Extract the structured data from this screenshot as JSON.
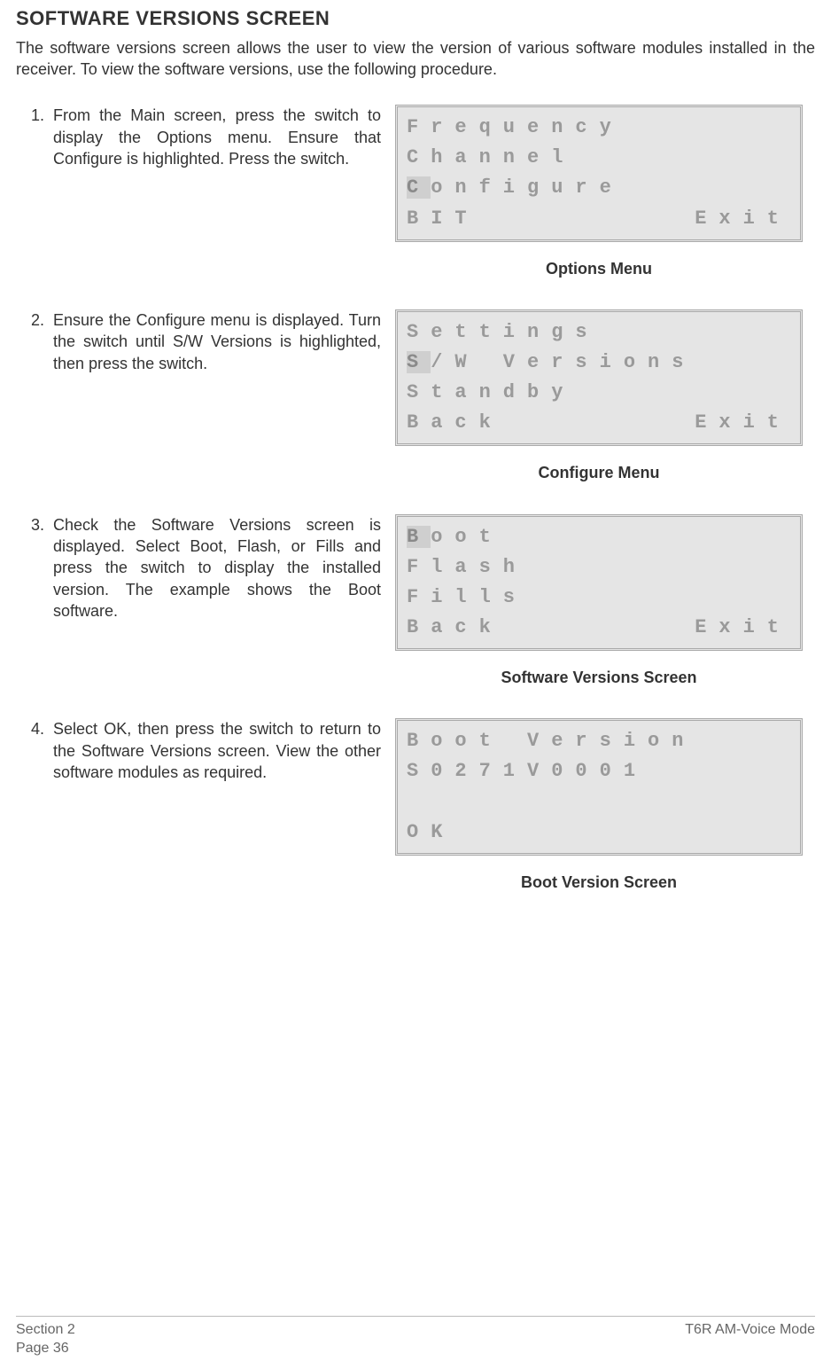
{
  "heading": "SOFTWARE VERSIONS SCREEN",
  "intro": "The software versions screen allows the user to view the version of various software modules installed in the receiver. To view the software versions, use the following procedure.",
  "steps": [
    {
      "num": "1.",
      "text": "From the Main screen, press the switch to display the Options menu. Ensure that Configure is highlighted. Press the switch.",
      "lcd": {
        "rows": [
          {
            "left": "Frequency",
            "right": "",
            "hl_first": false
          },
          {
            "left": "Channel",
            "right": "",
            "hl_first": false
          },
          {
            "left": "Configure",
            "right": "",
            "hl_first": true
          },
          {
            "left": "BIT",
            "right": "Exit",
            "hl_first": false
          }
        ]
      },
      "caption": "Options Menu"
    },
    {
      "num": "2.",
      "text": "Ensure the Configure menu is displayed. Turn the switch until S/W Versions is highlighted, then press the switch.",
      "lcd": {
        "rows": [
          {
            "left": "Settings",
            "right": "",
            "hl_first": false
          },
          {
            "left": "S/W Versions",
            "right": "",
            "hl_first": true
          },
          {
            "left": "Standby",
            "right": "",
            "hl_first": false
          },
          {
            "left": "Back",
            "right": "Exit",
            "hl_first": false
          }
        ]
      },
      "caption": "Configure Menu"
    },
    {
      "num": "3.",
      "text": "Check the Software Versions screen is displayed. Select Boot, Flash, or Fills and press the switch to display the installed version. The example shows the Boot software.",
      "lcd": {
        "rows": [
          {
            "left": "Boot",
            "right": "",
            "hl_first": true
          },
          {
            "left": "Flash",
            "right": "",
            "hl_first": false
          },
          {
            "left": "Fills",
            "right": "",
            "hl_first": false
          },
          {
            "left": "Back",
            "right": "Exit",
            "hl_first": false
          }
        ]
      },
      "caption": "Software Versions Screen"
    },
    {
      "num": "4.",
      "text": "Select OK, then press the switch to return to the Software Versions screen. View the other software modules as required.",
      "lcd": {
        "rows": [
          {
            "left": "Boot Version",
            "right": "",
            "hl_first": false
          },
          {
            "left": "S0271V0001",
            "right": "",
            "hl_first": false
          },
          {
            "left": " ",
            "right": "",
            "hl_first": false
          },
          {
            "left": "OK",
            "right": "",
            "hl_first": false
          }
        ]
      },
      "caption": "Boot Version Screen"
    }
  ],
  "footer": {
    "left_top": "Section 2",
    "left_bottom": "Page 36",
    "right": "T6R AM-Voice Mode"
  }
}
